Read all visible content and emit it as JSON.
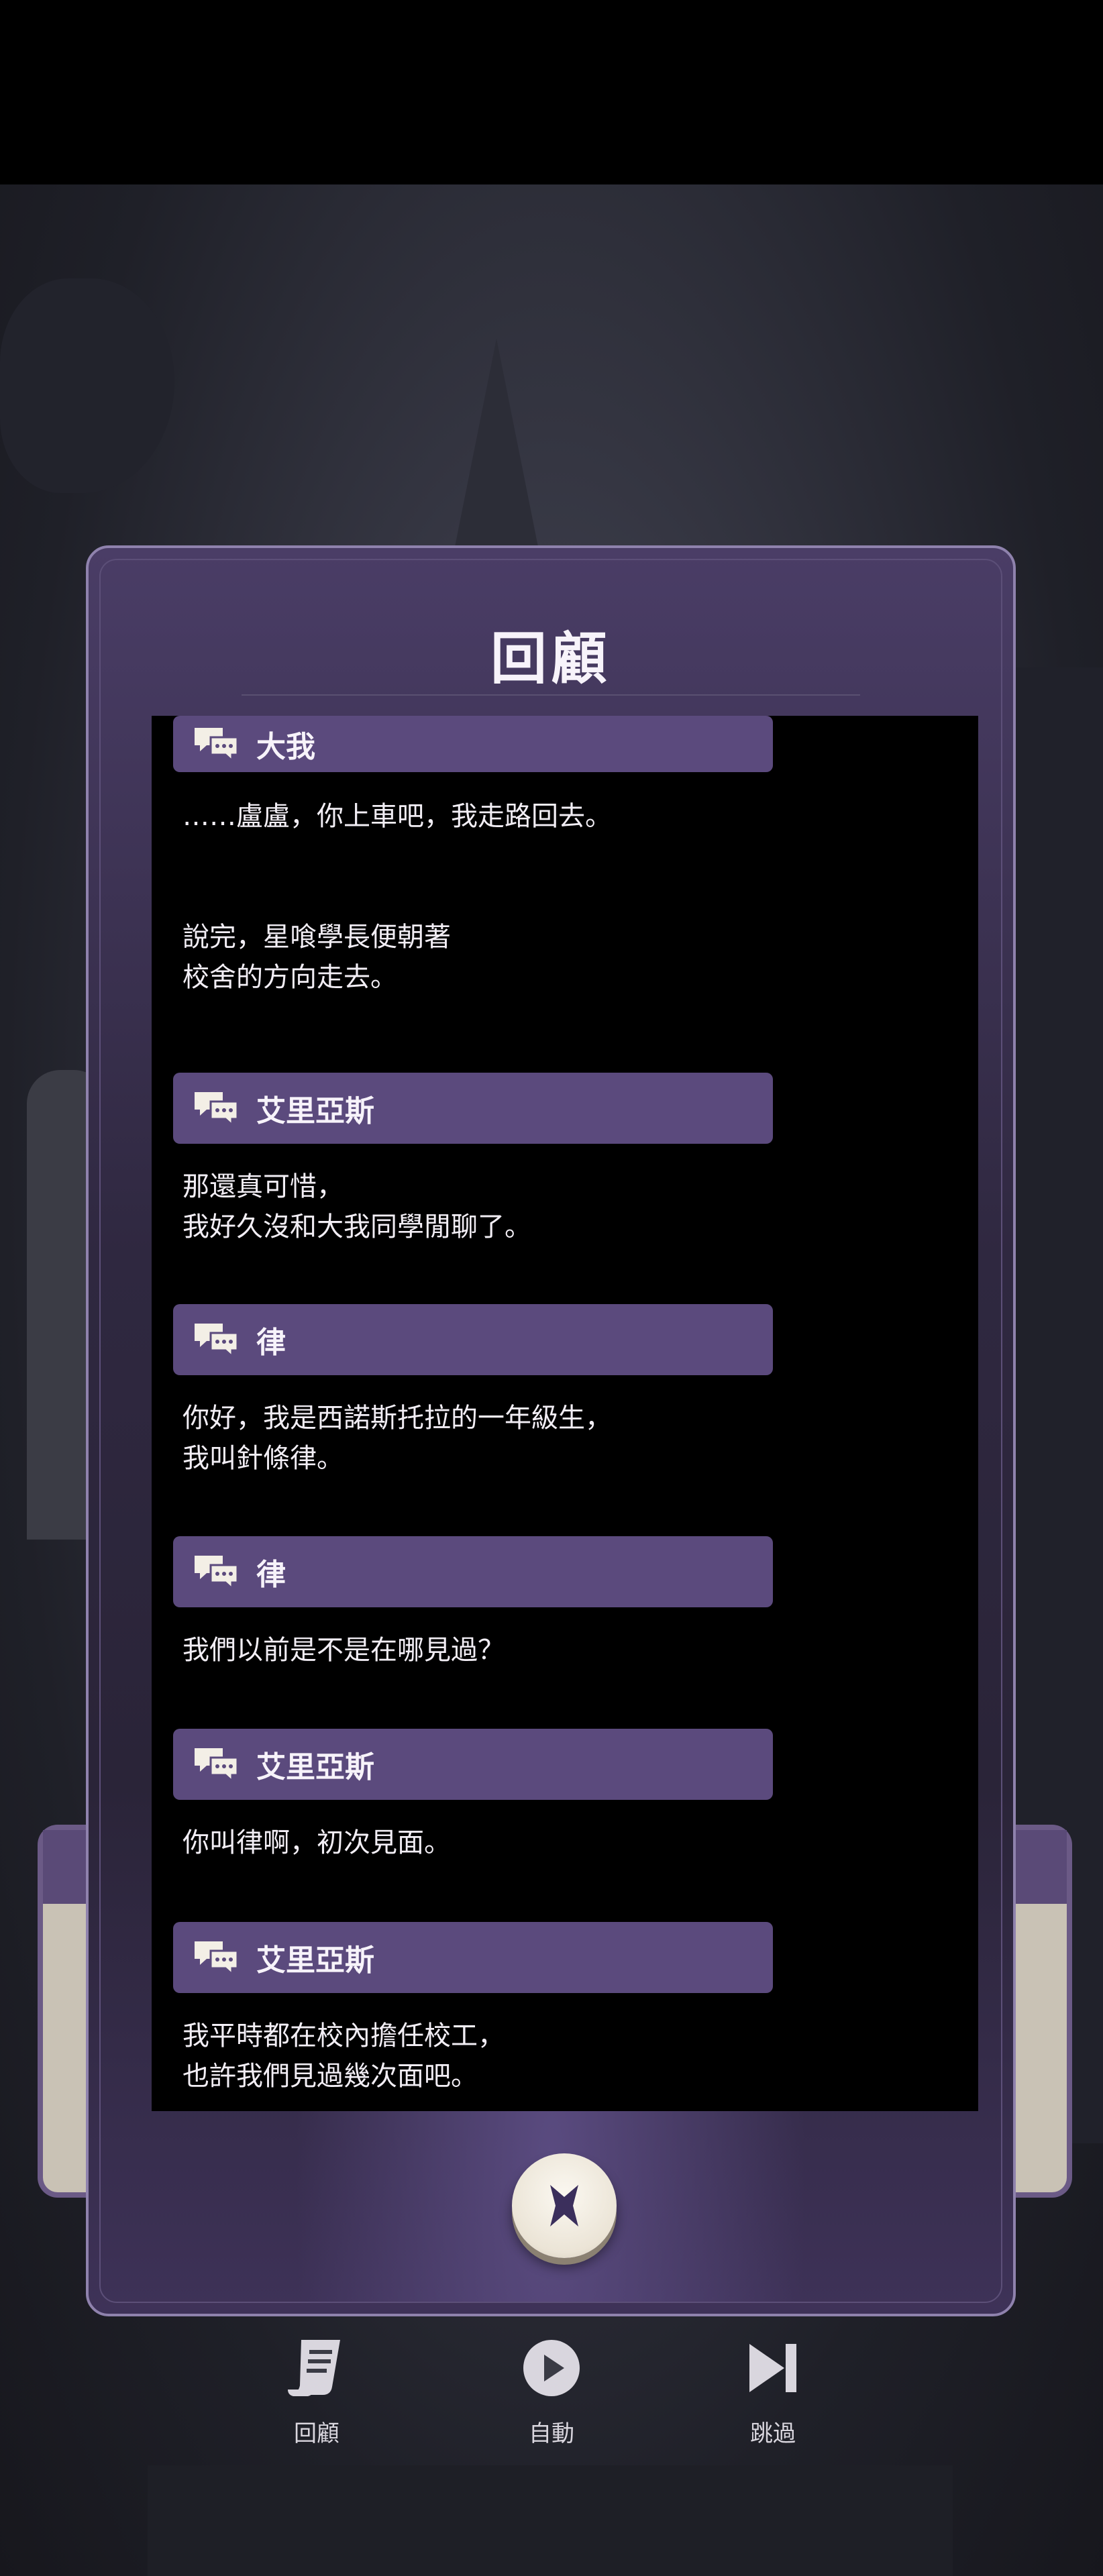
{
  "dialog": {
    "title": "回顧",
    "close_icon": "close-x-icon",
    "entries": [
      {
        "speaker": "大我",
        "text": "……盧盧，你上車吧，我走路回去。\n\n\n說完，星喰學長便朝著\n校舍的方向走去。"
      },
      {
        "speaker": "艾里亞斯",
        "text": "那還真可惜，\n我好久沒和大我同學閒聊了。"
      },
      {
        "speaker": "律",
        "text": "你好，我是西諾斯托拉的一年級生，\n我叫針條律。"
      },
      {
        "speaker": "律",
        "text": "我們以前是不是在哪見過？"
      },
      {
        "speaker": "艾里亞斯",
        "text": "你叫律啊，初次見面。"
      },
      {
        "speaker": "艾里亞斯",
        "text": "我平時都在校內擔任校工，\n也許我們見過幾次面吧。"
      }
    ],
    "entry_icon": "chat-bubbles-icon"
  },
  "bottom_nav": {
    "items": [
      {
        "label": "回顧",
        "icon": "scroll-log-icon"
      },
      {
        "label": "自動",
        "icon": "play-icon"
      },
      {
        "label": "跳過",
        "icon": "skip-icon"
      }
    ]
  },
  "colors": {
    "name_bar": "#5b4a7d",
    "dialog_border": "#8f82ad",
    "close_button_icon": "#3b2f5c"
  }
}
